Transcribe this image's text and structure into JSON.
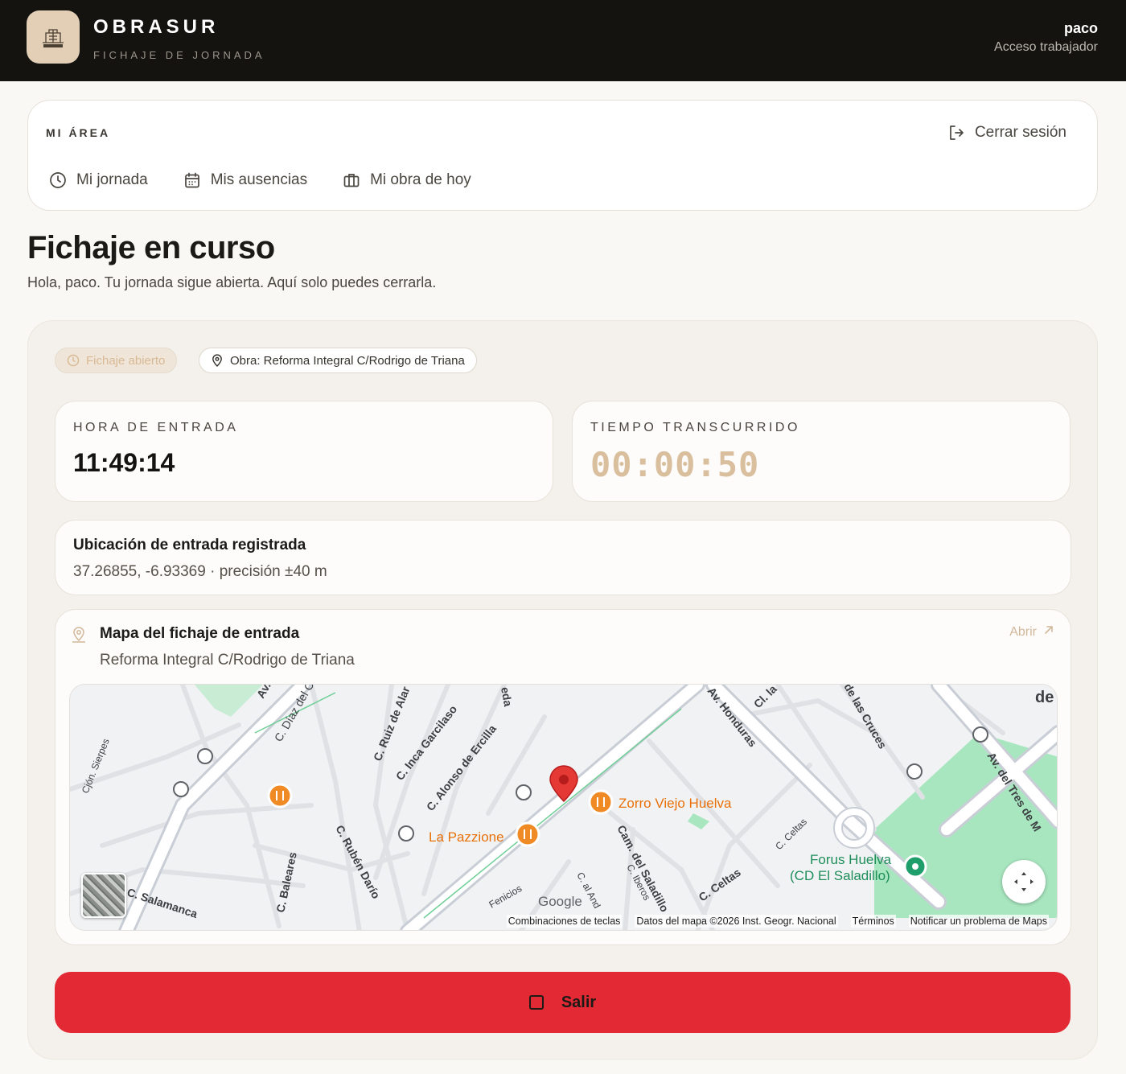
{
  "header": {
    "brand": "OBRASUR",
    "subtitle": "FICHAJE DE JORNADA",
    "logo_text": "OBRASUR",
    "user_name": "paco",
    "user_role": "Acceso trabajador"
  },
  "area": {
    "title": "MI ÁREA",
    "logout_label": "Cerrar sesión",
    "nav": [
      {
        "label": "Mi jornada",
        "icon": "clock-icon"
      },
      {
        "label": "Mis ausencias",
        "icon": "calendar-icon"
      },
      {
        "label": "Mi obra de hoy",
        "icon": "briefcase-icon"
      }
    ]
  },
  "page": {
    "title": "Fichaje en curso",
    "subtitle": "Hola, paco. Tu jornada sigue abierta. Aquí solo puedes cerrarla."
  },
  "status": {
    "open_chip": "Fichaje abierto",
    "obra_chip": "Obra: Reforma Integral C/Rodrigo de Triana"
  },
  "entry": {
    "label": "HORA DE ENTRADA",
    "time": "11:49:14"
  },
  "elapsed": {
    "label": "TIEMPO TRANSCURRIDO",
    "time": "00:00:50"
  },
  "location": {
    "title": "Ubicación de entrada registrada",
    "value": "37.26855, -6.93369 · precisión ±40 m"
  },
  "map": {
    "title": "Mapa del fichaje de entrada",
    "subtitle": "Reforma Integral C/Rodrigo de Triana",
    "open_label": "Abrir",
    "labels": {
      "zorro": "Zorro Viejo Huelva",
      "pazzione": "La Pazzione",
      "forus1": "Forus Huelva",
      "forus2": "(CD El Saladillo)",
      "honduras": "Av. Honduras",
      "cruces": "de las Cruces",
      "tres": "Av. del Tres de M",
      "garcilaso": "C. Inca Garcilaso",
      "ercilla": "C. Alonso de Ercilla",
      "ruiz": "C. Ruiz de Alar",
      "diaz": "C. Díaz del Ca",
      "sierpes": "Cjón. Sierpes",
      "baleares": "C. Baleares",
      "ruben": "C. Rubén Darío",
      "salamanca": "C. Salamanca",
      "saladillo": "Cam. del Saladillo",
      "iberos": "C. Iberos",
      "celtas1": "C. Celtas",
      "celtas2": "C. Celtas",
      "fenicios": "Fenicios",
      "andalucia": "C. al And",
      "google": "Google",
      "ave": "Av.",
      "cla": "Cl. la",
      "eda": "eda",
      "de": "de"
    },
    "footer": [
      "Combinaciones de teclas",
      "Datos del mapa ©2026 Inst. Geogr. Nacional",
      "Términos",
      "Notificar un problema de Maps"
    ],
    "colors": {
      "road": "#ffffff",
      "park": "#a8e6bf",
      "pin": "#e53935",
      "restaurant": "#f08a24",
      "label": "#3c4043"
    }
  },
  "exit_button": {
    "label": "Salir",
    "color": "#e32933"
  }
}
